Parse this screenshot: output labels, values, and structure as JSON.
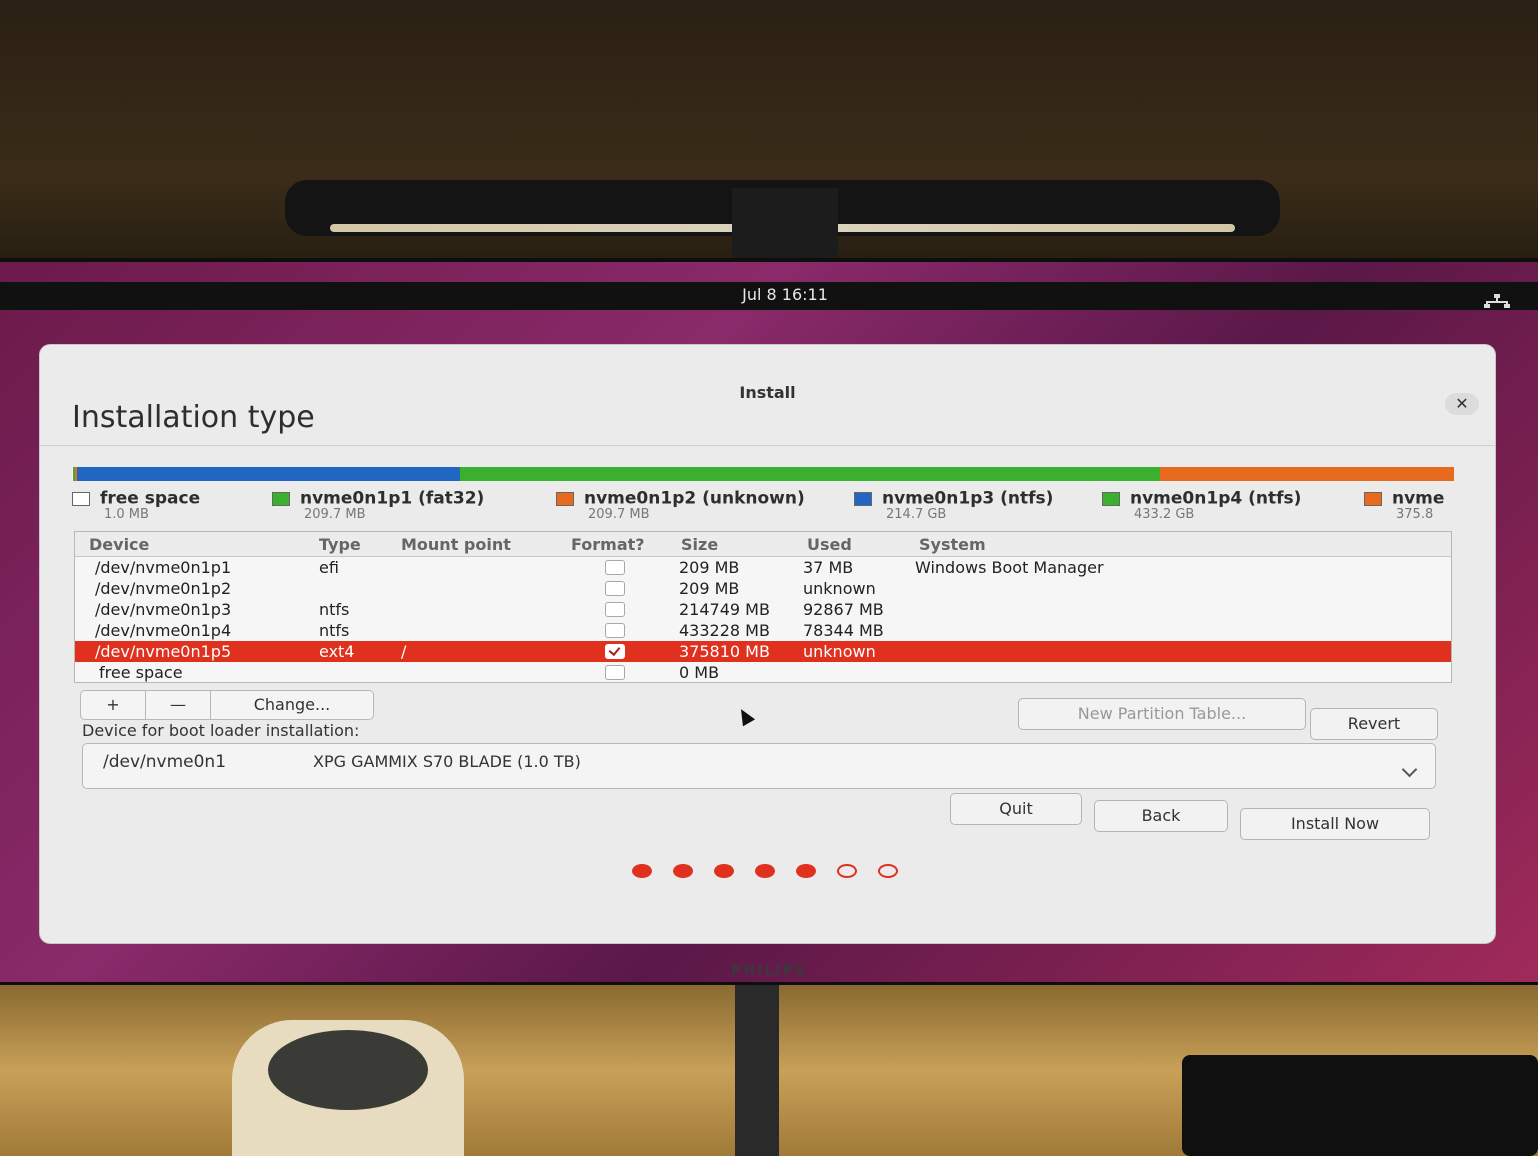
{
  "topbar": {
    "clock": "Jul 8  16:11",
    "network_icon": "network-wired-icon"
  },
  "monitor": {
    "brand": "PHILIPS"
  },
  "dialog": {
    "window_title": "Install",
    "close_label": "✕",
    "page_title": "Installation type"
  },
  "partition_bar": {
    "segments": [
      {
        "label": "free space",
        "color": "#ffffff"
      },
      {
        "label": "nvme0n1p1",
        "color": "#3bb02f"
      },
      {
        "label": "nvme0n1p2",
        "color": "#e86a1c"
      },
      {
        "label": "nvme0n1p3",
        "color": "#2266c4"
      },
      {
        "label": "nvme0n1p4",
        "color": "#3bb02f"
      },
      {
        "label": "nvme0n1p5",
        "color": "#e86a1c"
      }
    ]
  },
  "legend": [
    {
      "name": "free space",
      "size": "1.0 MB",
      "color": "#ffffff"
    },
    {
      "name": "nvme0n1p1 (fat32)",
      "size": "209.7 MB",
      "color": "#3bb02f"
    },
    {
      "name": "nvme0n1p2 (unknown)",
      "size": "209.7 MB",
      "color": "#e86a1c"
    },
    {
      "name": "nvme0n1p3 (ntfs)",
      "size": "214.7 GB",
      "color": "#2266c4"
    },
    {
      "name": "nvme0n1p4 (ntfs)",
      "size": "433.2 GB",
      "color": "#3bb02f"
    },
    {
      "name": "nvme",
      "size": "375.8",
      "color": "#e86a1c"
    }
  ],
  "table": {
    "headers": {
      "device": "Device",
      "type": "Type",
      "mount": "Mount point",
      "format": "Format?",
      "size": "Size",
      "used": "Used",
      "system": "System"
    },
    "rows": [
      {
        "device": "/dev/nvme0n1p1",
        "type": "efi",
        "mount": "",
        "format": false,
        "size": "209 MB",
        "used": "37 MB",
        "system": "Windows Boot Manager"
      },
      {
        "device": "/dev/nvme0n1p2",
        "type": "",
        "mount": "",
        "format": false,
        "size": "209 MB",
        "used": "unknown",
        "system": ""
      },
      {
        "device": "/dev/nvme0n1p3",
        "type": "ntfs",
        "mount": "",
        "format": false,
        "size": "214749 MB",
        "used": "92867 MB",
        "system": ""
      },
      {
        "device": "/dev/nvme0n1p4",
        "type": "ntfs",
        "mount": "",
        "format": false,
        "size": "433228 MB",
        "used": "78344 MB",
        "system": ""
      },
      {
        "device": "/dev/nvme0n1p5",
        "type": "ext4",
        "mount": "/",
        "format": true,
        "size": "375810 MB",
        "used": "unknown",
        "system": ""
      },
      {
        "device": "free space",
        "type": "",
        "mount": "",
        "format": false,
        "size": "0 MB",
        "used": "",
        "system": ""
      }
    ],
    "selected_row": 4
  },
  "toolbar": {
    "add": "+",
    "remove": "—",
    "change": "Change..."
  },
  "actions": {
    "new_table": "New Partition Table...",
    "revert": "Revert"
  },
  "bootloader": {
    "label": "Device for boot loader installation:",
    "device": "/dev/nvme0n1",
    "name": "XPG GAMMIX S70 BLADE (1.0 TB)"
  },
  "nav": {
    "quit": "Quit",
    "back": "Back",
    "install": "Install Now"
  },
  "progress": {
    "total_steps": 7,
    "completed_steps": 5
  },
  "accent_color": "#e0301e"
}
